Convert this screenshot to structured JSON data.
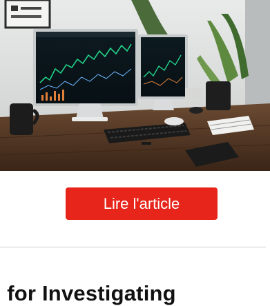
{
  "article": {
    "image_subject": "desk-with-trading-monitors",
    "read_button_label": "Lire l'article",
    "next_title_partial": "s for Investigating"
  },
  "colors": {
    "accent": "#e8251b",
    "divider": "#d0d0d0",
    "title_text": "#111111"
  }
}
